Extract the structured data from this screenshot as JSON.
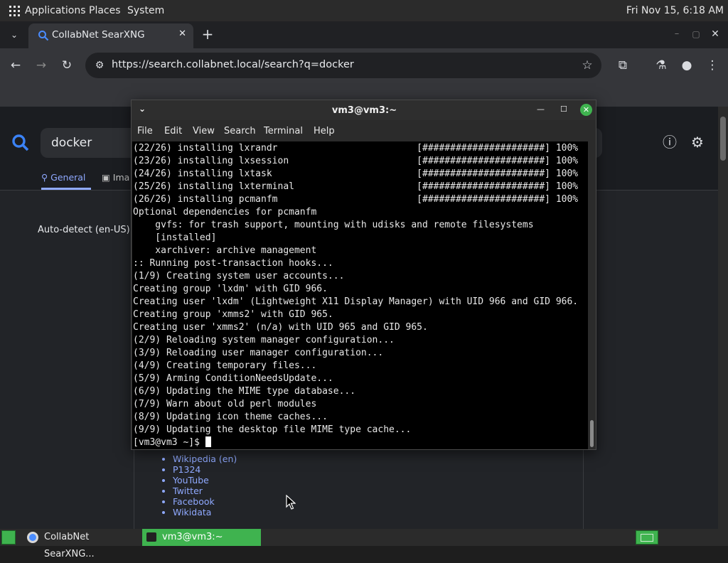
{
  "top_panel": {
    "applications": "Applications",
    "places": "Places",
    "system": "System",
    "clock": "Fri Nov 15,  6:18 AM"
  },
  "browser": {
    "tab_title": "CollabNet SearXNG",
    "url": "https://search.collabnet.local/search?q=docker",
    "new_tab": "+",
    "tab_close": "✕"
  },
  "searx": {
    "query": "docker",
    "tab_general": "General",
    "tab_images": "Ima",
    "autodetect": "Auto-detect (en-US)",
    "links": [
      "Wikipedia (en)",
      "P1324",
      "YouTube",
      "Twitter",
      "Facebook",
      "Wikidata"
    ]
  },
  "terminal": {
    "title": "vm3@vm3:~",
    "menu": [
      "File",
      "Edit",
      "View",
      "Search",
      "Terminal",
      "Help"
    ],
    "lines": [
      "(22/26) installing lxrandr                         [######################] 100%",
      "(23/26) installing lxsession                       [######################] 100%",
      "(24/26) installing lxtask                          [######################] 100%",
      "(25/26) installing lxterminal                      [######################] 100%",
      "(26/26) installing pcmanfm                         [######################] 100%",
      "Optional dependencies for pcmanfm",
      "    gvfs: for trash support, mounting with udisks and remote filesystems",
      "    [installed]",
      "    xarchiver: archive management",
      ":: Running post-transaction hooks...",
      "(1/9) Creating system user accounts...",
      "Creating group 'lxdm' with GID 966.",
      "Creating user 'lxdm' (Lightweight X11 Display Manager) with UID 966 and GID 966.",
      "Creating group 'xmms2' with GID 965.",
      "Creating user 'xmms2' (n/a) with UID 965 and GID 965.",
      "(2/9) Reloading system manager configuration...",
      "(3/9) Reloading user manager configuration...",
      "(4/9) Creating temporary files...",
      "(5/9) Arming ConditionNeedsUpdate...",
      "(6/9) Updating the MIME type database...",
      "(7/9) Warn about old perl modules",
      "(8/9) Updating icon theme caches...",
      "(9/9) Updating the desktop file MIME type cache..."
    ],
    "prompt": "[vm3@vm3 ~]$ "
  },
  "taskbar": {
    "browser_task": "CollabNet SearXNG...",
    "terminal_task": "vm3@vm3:~"
  },
  "colors": {
    "accent_green": "#3fb34f",
    "link_blue": "#8fa9ff",
    "searx_blue": "#3b82f6"
  }
}
